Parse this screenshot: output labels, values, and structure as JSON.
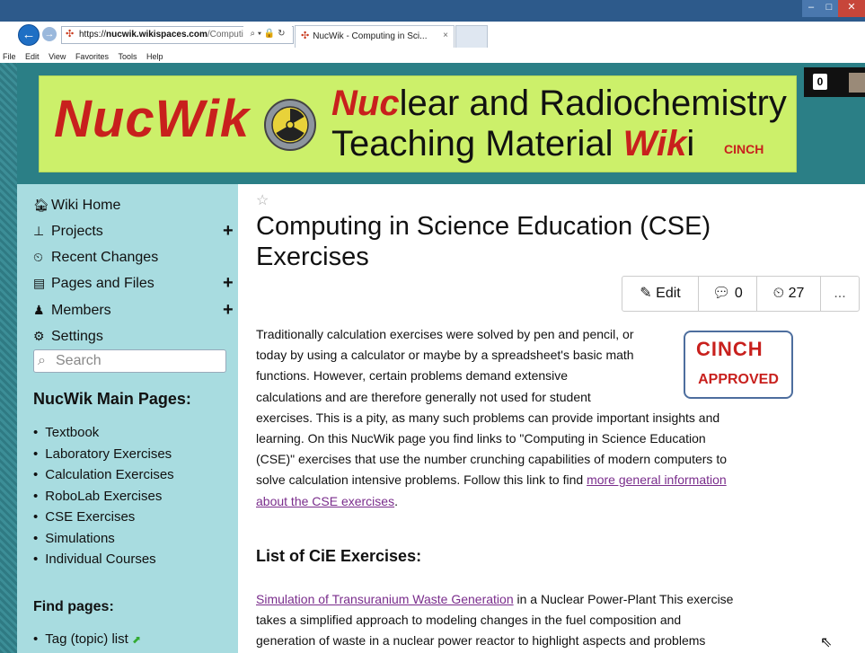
{
  "browser": {
    "url_prefix": "https://",
    "url_host": "nucwik.wikispaces.com",
    "url_rest": "/Computi",
    "address_icons": "⌕ ▾ 🔒 ↻",
    "tab_title": "NucWik - Computing in Sci...",
    "tab_close": "×",
    "menu": [
      "File",
      "Edit",
      "View",
      "Favorites",
      "Tools",
      "Help"
    ]
  },
  "banner": {
    "nucwik": "NucWik",
    "line1_em": "Nuc",
    "line1_rest": "lear and Radiochemistry",
    "line2_pre": "Teaching Material ",
    "line2_em": "Wik",
    "line2_post": "i",
    "cinch": "CINCH"
  },
  "counter": {
    "value": "0"
  },
  "sidebar": {
    "nav": [
      {
        "label": "Wiki Home",
        "icon": "home-icon"
      },
      {
        "label": "Projects",
        "icon": "sitemap-icon"
      },
      {
        "label": "Recent Changes",
        "icon": "clock-icon"
      },
      {
        "label": "Pages and Files",
        "icon": "file-icon"
      },
      {
        "label": "Members",
        "icon": "user-icon"
      },
      {
        "label": "Settings",
        "icon": "gear-icon"
      }
    ],
    "search_placeholder": "Search",
    "main_pages_title": "NucWik Main Pages:",
    "main_pages": [
      "Textbook",
      "Laboratory Exercises",
      "Calculation Exercises",
      "RoboLab Exercises",
      "CSE Exercises",
      "Simulations",
      "Individual Courses"
    ],
    "find_title": "Find pages:",
    "find_pages": [
      "Tag (topic) list"
    ]
  },
  "content": {
    "title": "Computing in Science Education (CSE) Exercises",
    "edit_label": "Edit",
    "comments_count": "0",
    "history_count": "27",
    "more_label": "...",
    "badge_top": "CINCH",
    "badge_bottom": "APPROVED",
    "intro_lines": [
      "Traditionally calculation exercises were solved by pen and pencil, or",
      "today by using a calculator or maybe by a spreadsheet's basic math",
      "functions. However, certain problems demand extensive",
      "calculations and are therefore generally not used for student",
      "exercises. This is a pity, as many such problems can provide important insights and",
      "learning. On this NucWik page you find links to \"Computing in Science Education",
      "(CSE)\" exercises that use the number crunching capabilities of modern computers to"
    ],
    "intro_last_pre": "solve calculation intensive problems. Follow this link to find ",
    "intro_link_1": "more general information",
    "intro_link_2": "about the CSE exercises",
    "intro_end": ".",
    "list_title": "List of CiE Exercises:",
    "exercise_link": "Simulation of Transuranium Waste Generation",
    "exercise_text_1": " in a Nuclear Power-Plant This exercise",
    "exercise_text_2": "takes a simplified approach to modeling changes in the fuel composition and",
    "exercise_text_3": "generation of waste in a nuclear power reactor to highlight aspects and problems"
  }
}
